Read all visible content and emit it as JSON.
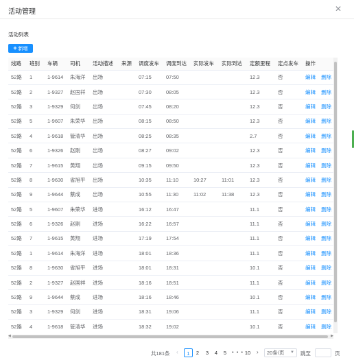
{
  "dialog": {
    "title": "活动管理",
    "close_icon": "close-icon"
  },
  "section": {
    "label": "活动列表",
    "add_label": "新增"
  },
  "table": {
    "headers": [
      "线路",
      "班别",
      "车辆",
      "司机",
      "活动描述",
      "来源",
      "调度发车",
      "调度到达",
      "实际发车",
      "实际到达",
      "定额里程",
      "定点发车",
      "操作"
    ],
    "edit_label": "编辑",
    "delete_label": "删除",
    "rows": [
      [
        "52路",
        "1",
        "1-9614",
        "朱海洋",
        "出场",
        "",
        "07:15",
        "07:50",
        "",
        "",
        "12.3",
        "否"
      ],
      [
        "52路",
        "2",
        "1-9327",
        "赵国祥",
        "出场",
        "",
        "07:30",
        "08:05",
        "",
        "",
        "12.3",
        "否"
      ],
      [
        "52路",
        "3",
        "1-9329",
        "何剑",
        "出场",
        "",
        "07:45",
        "08:20",
        "",
        "",
        "12.3",
        "否"
      ],
      [
        "52路",
        "5",
        "1-9607",
        "朱荣华",
        "出场",
        "",
        "08:15",
        "08:50",
        "",
        "",
        "12.3",
        "否"
      ],
      [
        "52路",
        "4",
        "1-9618",
        "管清华",
        "出场",
        "",
        "08:25",
        "08:35",
        "",
        "",
        "2.7",
        "否"
      ],
      [
        "52路",
        "6",
        "1-9326",
        "赵刚",
        "出场",
        "",
        "08:27",
        "09:02",
        "",
        "",
        "12.3",
        "否"
      ],
      [
        "52路",
        "7",
        "1-9615",
        "黄翔",
        "出场",
        "",
        "09:15",
        "09:50",
        "",
        "",
        "12.3",
        "否"
      ],
      [
        "52路",
        "8",
        "1-9630",
        "省旭平",
        "出场",
        "",
        "10:35",
        "11:10",
        "10:27",
        "11:01",
        "12.3",
        "否"
      ],
      [
        "52路",
        "9",
        "1-9644",
        "蔡成",
        "出场",
        "",
        "10:55",
        "11:30",
        "11:02",
        "11:38",
        "12.3",
        "否"
      ],
      [
        "52路",
        "5",
        "1-9607",
        "朱荣华",
        "进场",
        "",
        "16:12",
        "16:47",
        "",
        "",
        "11.1",
        "否"
      ],
      [
        "52路",
        "6",
        "1-9326",
        "赵刚",
        "进场",
        "",
        "16:22",
        "16:57",
        "",
        "",
        "11.1",
        "否"
      ],
      [
        "52路",
        "7",
        "1-9615",
        "黄翔",
        "进场",
        "",
        "17:19",
        "17:54",
        "",
        "",
        "11.1",
        "否"
      ],
      [
        "52路",
        "1",
        "1-9614",
        "朱海洋",
        "进场",
        "",
        "18:01",
        "18:36",
        "",
        "",
        "11.1",
        "否"
      ],
      [
        "52路",
        "8",
        "1-9630",
        "省旭平",
        "进场",
        "",
        "18:01",
        "18:31",
        "",
        "",
        "10.1",
        "否"
      ],
      [
        "52路",
        "2",
        "1-9327",
        "赵国祥",
        "进场",
        "",
        "18:16",
        "18:51",
        "",
        "",
        "11.1",
        "否"
      ],
      [
        "52路",
        "9",
        "1-9644",
        "蔡成",
        "进场",
        "",
        "18:16",
        "18:46",
        "",
        "",
        "10.1",
        "否"
      ],
      [
        "52路",
        "3",
        "1-9329",
        "何剑",
        "进场",
        "",
        "18:31",
        "19:06",
        "",
        "",
        "11.1",
        "否"
      ],
      [
        "52路",
        "4",
        "1-9618",
        "管清华",
        "进场",
        "",
        "18:32",
        "19:02",
        "",
        "",
        "10.1",
        "否"
      ]
    ]
  },
  "pagination": {
    "total": "共181条",
    "pages": [
      "1",
      "2",
      "3",
      "4",
      "5"
    ],
    "current": "1",
    "ellipsis": "• • •",
    "last_page": "10",
    "page_size": "20条/页",
    "jump_label": "跳至",
    "page_suffix": "页"
  },
  "colors": {
    "accent": "#1890ff",
    "side_marker": "#4caf50"
  }
}
